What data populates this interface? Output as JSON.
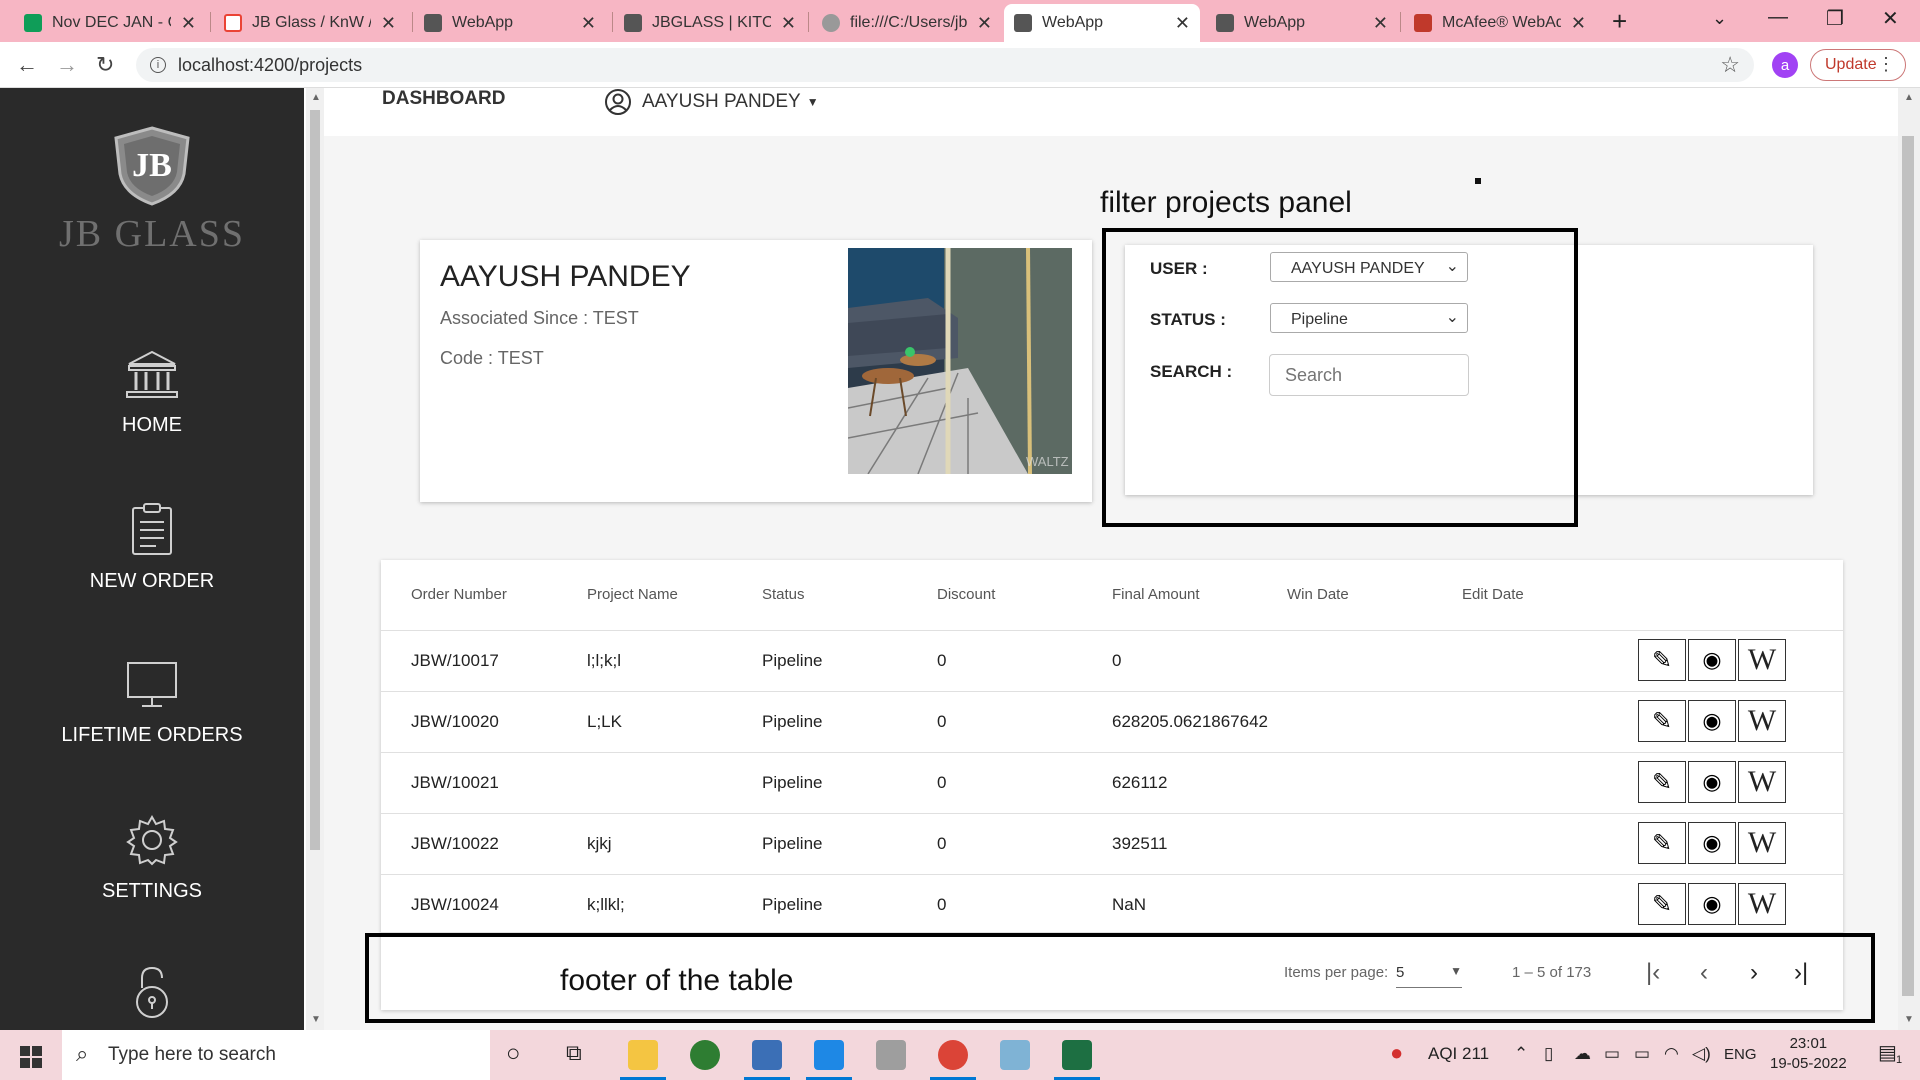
{
  "browser": {
    "tabs": [
      {
        "title": "Nov DEC JAN - Go",
        "color": "#0f9d58"
      },
      {
        "title": "JB Glass / KnW / W",
        "color": "#ea4335"
      },
      {
        "title": "WebApp",
        "color": "#444444"
      },
      {
        "title": "JBGLASS | KITCHE",
        "color": "#444444"
      },
      {
        "title": "file:///C:/Users/jb",
        "color": "#777777"
      },
      {
        "title": "WebApp",
        "color": "#444444"
      },
      {
        "title": "WebApp",
        "color": "#444444"
      },
      {
        "title": "McAfee® WebAd",
        "color": "#c0392b"
      }
    ],
    "url": "localhost:4200/projects",
    "profile_initial": "a",
    "update_label": "Update"
  },
  "sidebar": {
    "brand": "JB GLASS",
    "logo_text": "JB",
    "items": [
      {
        "label": "HOME",
        "icon": "bank-icon"
      },
      {
        "label": "NEW ORDER",
        "icon": "clipboard-icon"
      },
      {
        "label": "LIFETIME ORDERS",
        "icon": "monitor-icon"
      },
      {
        "label": "SETTINGS",
        "icon": "gear-icon"
      },
      {
        "label": "",
        "icon": "lock-icon"
      }
    ]
  },
  "topnav": {
    "dashboard_label": "DASHBOARD",
    "user_name": "AAYUSH PANDEY"
  },
  "annotations": {
    "filter_panel": "filter projects panel",
    "table_footer": "footer of the table"
  },
  "profile": {
    "name": "AAYUSH PANDEY",
    "associated_since": "Associated Since : TEST",
    "code": "Code : TEST",
    "image_watermark": "WALTZ"
  },
  "filter": {
    "user_label": "USER :",
    "user_value": "AAYUSH PANDEY",
    "status_label": "STATUS :",
    "status_value": "Pipeline",
    "search_label": "SEARCH :",
    "search_placeholder": "Search"
  },
  "table": {
    "columns": [
      "Order Number",
      "Project Name",
      "Status",
      "Discount",
      "Final Amount",
      "Win Date",
      "Edit Date"
    ],
    "rows": [
      {
        "order": "JBW/10017",
        "project": "l;l;k;l",
        "status": "Pipeline",
        "discount": "0",
        "amount": "0",
        "win_date": "",
        "edit_date": ""
      },
      {
        "order": "JBW/10020",
        "project": "L;LK",
        "status": "Pipeline",
        "discount": "0",
        "amount": "628205.0621867642",
        "win_date": "",
        "edit_date": ""
      },
      {
        "order": "JBW/10021",
        "project": "",
        "status": "Pipeline",
        "discount": "0",
        "amount": "626112",
        "win_date": "",
        "edit_date": ""
      },
      {
        "order": "JBW/10022",
        "project": "kjkj",
        "status": "Pipeline",
        "discount": "0",
        "amount": "392511",
        "win_date": "",
        "edit_date": ""
      },
      {
        "order": "JBW/10024",
        "project": "k;llkl;",
        "status": "Pipeline",
        "discount": "0",
        "amount": "NaN",
        "win_date": "",
        "edit_date": ""
      }
    ],
    "action_w_label": "W"
  },
  "paginator": {
    "items_per_page_label": "Items per page:",
    "page_size": "5",
    "range_label": "1 – 5 of 173"
  },
  "taskbar": {
    "search_placeholder": "Type here to search",
    "aqi": "AQI 211",
    "language": "ENG",
    "time": "23:01",
    "date": "19-05-2022",
    "notification_count": "1"
  }
}
